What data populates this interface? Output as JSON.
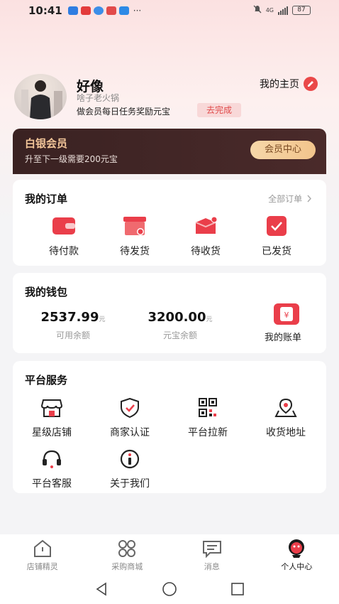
{
  "status_bar": {
    "time": "10:41",
    "battery": "87",
    "network": "4G"
  },
  "profile": {
    "name": "好像",
    "subtitle": "啥子老火锅",
    "task_text": "做会员每日任务奖励元宝",
    "task_button": "去完成",
    "homepage_label": "我的主页"
  },
  "member": {
    "title": "白银会员",
    "subtitle": "升至下一级需要200元宝",
    "button": "会员中心",
    "colors": {
      "card_bg": "#3a2222",
      "gold": "#f3c69a"
    }
  },
  "orders": {
    "title": "我的订单",
    "view_all": "全部订单",
    "items": [
      {
        "label": "待付款",
        "icon": "wallet-icon"
      },
      {
        "label": "待发货",
        "icon": "box-clock-icon"
      },
      {
        "label": "待收货",
        "icon": "package-icon"
      },
      {
        "label": "已发货",
        "icon": "check-box-icon"
      }
    ]
  },
  "wallet": {
    "title": "我的钱包",
    "available": {
      "value": "2537.99",
      "unit": "元",
      "label": "可用余额"
    },
    "ingot": {
      "value": "3200.00",
      "unit": "元",
      "label": "元宝余额"
    },
    "bill_label": "我的账单"
  },
  "services": {
    "title": "平台服务",
    "items": [
      {
        "label": "星级店铺",
        "icon": "shop-icon"
      },
      {
        "label": "商家认证",
        "icon": "shield-check-icon"
      },
      {
        "label": "平台拉新",
        "icon": "qr-code-icon"
      },
      {
        "label": "收货地址",
        "icon": "location-icon"
      },
      {
        "label": "平台客服",
        "icon": "headset-icon"
      },
      {
        "label": "关于我们",
        "icon": "info-icon"
      }
    ]
  },
  "bottom_nav": [
    {
      "label": "店铺精灵",
      "icon": "home-icon"
    },
    {
      "label": "采购商城",
      "icon": "grid-icon"
    },
    {
      "label": "消息",
      "icon": "message-icon"
    },
    {
      "label": "个人中心",
      "icon": "mascot-icon",
      "active": true
    }
  ],
  "accent_color": "#ea3e4a"
}
